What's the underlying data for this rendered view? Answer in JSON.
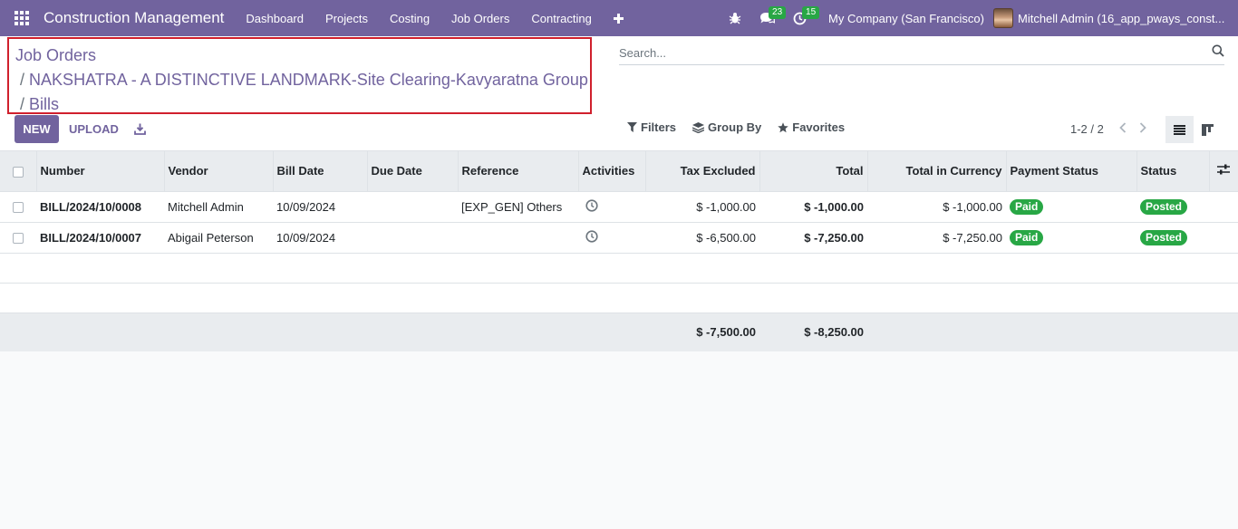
{
  "navbar": {
    "app_title": "Construction Management",
    "menu": [
      "Dashboard",
      "Projects",
      "Costing",
      "Job Orders",
      "Contracting"
    ],
    "messages_count": "23",
    "activities_count": "15",
    "company": "My Company (San Francisco)",
    "user": "Mitchell Admin (16_app_pways_const..."
  },
  "breadcrumb": {
    "items": [
      "Job Orders",
      "NAKSHATRA - A DISTINCTIVE LANDMARK-Site Clearing-Kavyaratna Group",
      "Bills"
    ],
    "separator": "/"
  },
  "search": {
    "placeholder": "Search..."
  },
  "toolbar": {
    "new_label": "NEW",
    "upload_label": "UPLOAD"
  },
  "filters": {
    "filters_label": "Filters",
    "group_by_label": "Group By",
    "favorites_label": "Favorites"
  },
  "pager": {
    "value": "1-2 / 2"
  },
  "table": {
    "columns": [
      "Number",
      "Vendor",
      "Bill Date",
      "Due Date",
      "Reference",
      "Activities",
      "Tax Excluded",
      "Total",
      "Total in Currency",
      "Payment Status",
      "Status"
    ],
    "rows": [
      {
        "number": "BILL/2024/10/0008",
        "vendor": "Mitchell Admin",
        "bill_date": "10/09/2024",
        "due_date": "",
        "reference": "[EXP_GEN] Others",
        "tax_excluded": "$ -1,000.00",
        "total": "$ -1,000.00",
        "total_currency": "$ -1,000.00",
        "payment_status": "Paid",
        "status": "Posted"
      },
      {
        "number": "BILL/2024/10/0007",
        "vendor": "Abigail Peterson",
        "bill_date": "10/09/2024",
        "due_date": "",
        "reference": "",
        "tax_excluded": "$ -6,500.00",
        "total": "$ -7,250.00",
        "total_currency": "$ -7,250.00",
        "payment_status": "Paid",
        "status": "Posted"
      }
    ],
    "totals": {
      "tax_excluded": "$ -7,500.00",
      "total": "$ -8,250.00"
    }
  },
  "colors": {
    "brand": "#71639e",
    "success": "#28a745"
  }
}
